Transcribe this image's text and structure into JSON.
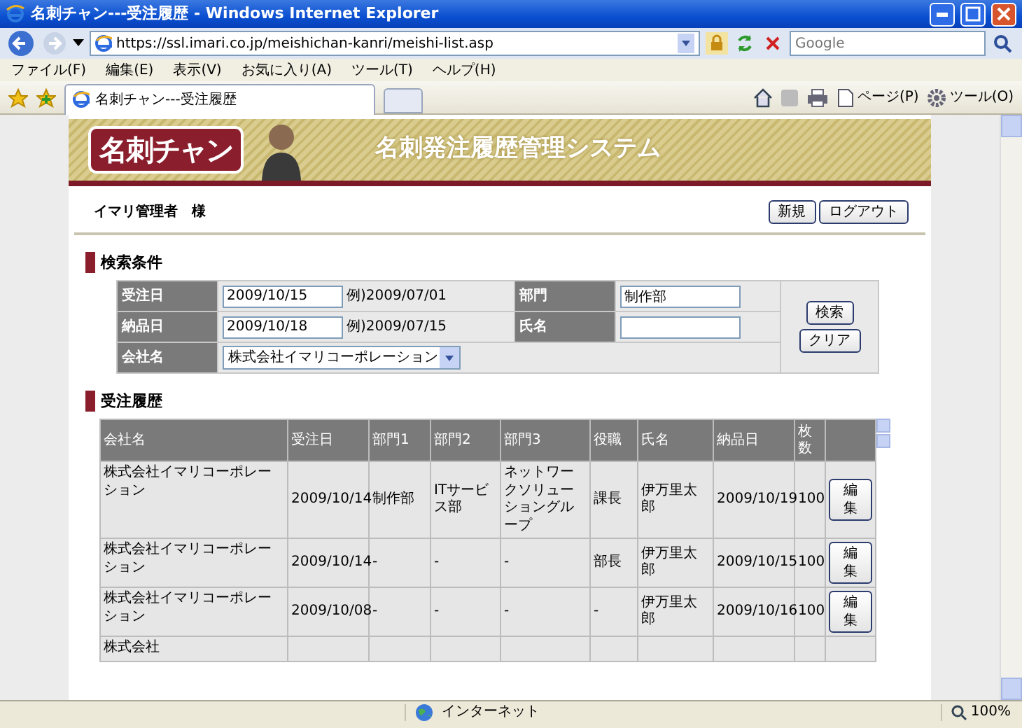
{
  "window": {
    "title": "名刺チャン---受注履歴 - Windows Internet Explorer"
  },
  "browser": {
    "address": "https://ssl.imari.co.jp/meishichan-kanri/meishi-list.asp",
    "search_placeholder": "Google",
    "menu": [
      "ファイル(F)",
      "編集(E)",
      "表示(V)",
      "お気に入り(A)",
      "ツール(T)",
      "ヘルプ(H)"
    ],
    "tab_title": "名刺チャン---受注履歴",
    "toolbar": [
      "ページ(P)",
      "ツール(O)"
    ],
    "status": "インターネット",
    "zoom": "100%"
  },
  "page": {
    "logo": "名刺チャン",
    "system_title": "名刺発注履歴管理システム",
    "user": "イマリ管理者　様",
    "buttons": [
      "新規",
      "ログアウト"
    ],
    "search": {
      "heading": "検索条件",
      "order_date": {
        "label": "受注日",
        "value": "2009/10/15",
        "example": "例)2009/07/01"
      },
      "department": {
        "label": "部門",
        "value": "制作部"
      },
      "delivery_date": {
        "label": "納品日",
        "value": "2009/10/18",
        "example": "例)2009/07/15"
      },
      "name": {
        "label": "氏名"
      },
      "company": {
        "label": "会社名",
        "value": "株式会社イマリコーポレーション"
      },
      "buttons": [
        "検索",
        "クリア"
      ]
    },
    "history": {
      "heading": "受注履歴",
      "columns": [
        "会社名",
        "受注日",
        "部門1",
        "部門2",
        "部門3",
        "役職",
        "氏名",
        "納品日",
        "枚数"
      ],
      "rows": [
        {
          "cells": [
            "株式会社イマリコーポレーション",
            "2009/10/14",
            "制作部",
            "ITサービス部",
            "ネットワークソリューショングループ",
            "課長",
            "伊万里太郎",
            "2009/10/19",
            "100"
          ],
          "action": "編集"
        },
        {
          "cells": [
            "株式会社イマリコーポレーション",
            "2009/10/14",
            "-",
            "-",
            "-",
            "部長",
            "伊万里太郎",
            "2009/10/15",
            "100"
          ],
          "action": "編集"
        },
        {
          "cells": [
            "株式会社イマリコーポレーション",
            "2009/10/08",
            "-",
            "-",
            "-",
            "-",
            "伊万里太郎",
            "2009/10/16",
            "100"
          ],
          "action": "編集"
        },
        {
          "cells": [
            "株式会社"
          ]
        }
      ]
    }
  }
}
